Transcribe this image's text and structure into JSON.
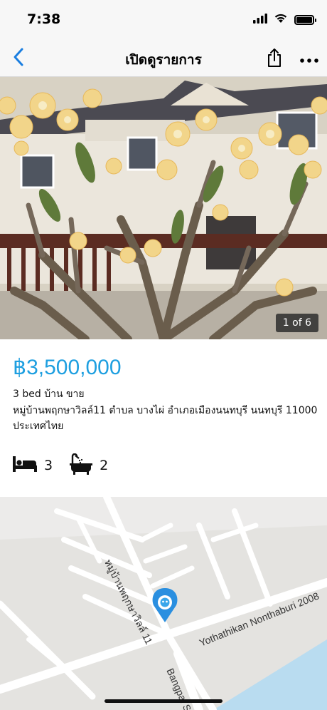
{
  "status_bar": {
    "time": "7:38"
  },
  "nav": {
    "title": "เปิดดูรายการ"
  },
  "photo": {
    "counter": "1 of 6"
  },
  "listing": {
    "price": "฿3,500,000",
    "subtitle": "3 bed บ้าน ขาย",
    "address": "หมู่บ้านพฤกษาวิลล์11 ตำบล บางไผ่ อำเภอเมืองนนทบุรี นนทบุรี 11000 ประเทศไทย",
    "bedrooms": "3",
    "bathrooms": "2"
  },
  "map": {
    "labels": {
      "village": "หมู่บ้านพฤกษาวิลล์ 11",
      "road": "Yothathikan Nonthaburi 2008",
      "road2": "Bangpai S"
    }
  },
  "colors": {
    "accent": "#1e9fe0",
    "nav_tint": "#1a7ee0"
  },
  "icons": [
    "back-chevron-icon",
    "share-icon",
    "more-icon",
    "bed-icon",
    "bathtub-icon",
    "map-pin-icon"
  ]
}
